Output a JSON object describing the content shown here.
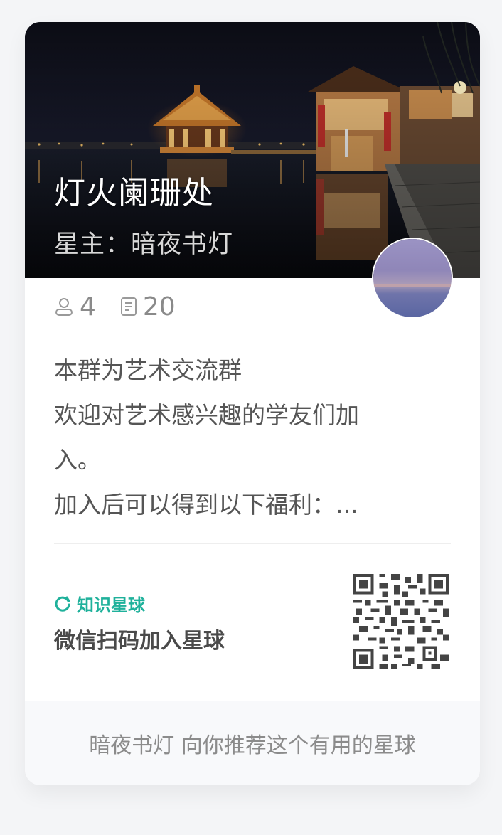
{
  "card": {
    "title": "灯火阑珊处",
    "owner_label": "星主：",
    "owner_name": "暗夜书灯",
    "avatar_icon": "avatar-lake-photo"
  },
  "stats": {
    "members_icon": "user-icon",
    "members": "4",
    "posts_icon": "document-icon",
    "posts": "20"
  },
  "description": {
    "lines": [
      "本群为艺术交流群",
      "欢迎对艺术感兴趣的学友们加",
      "入。",
      "加入后可以得到以下福利：..."
    ]
  },
  "brand": {
    "icon": "zsxq-logo-icon",
    "name": "知识星球",
    "color": "#1fb19b"
  },
  "scan_text": "微信扫码加入星球",
  "footer": {
    "text": "暗夜书灯 向你推荐这个有用的星球"
  }
}
